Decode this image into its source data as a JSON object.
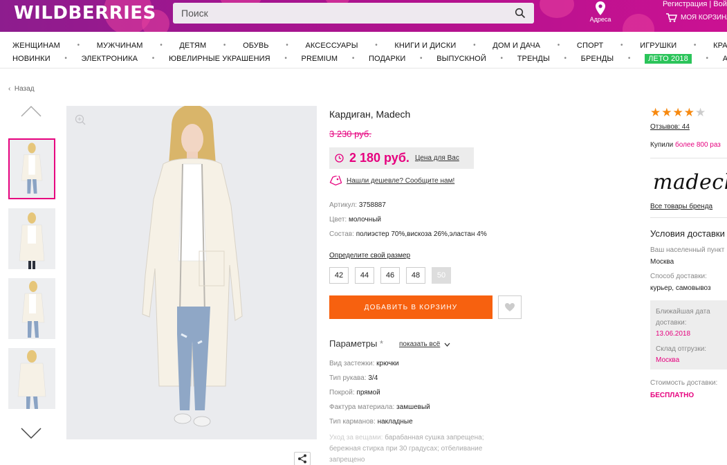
{
  "header": {
    "logo": "WILDBERRIES",
    "search_placeholder": "Поиск",
    "address_label": "Адреса",
    "auth": "Регистрация | Войт",
    "cart_label": "МОЯ КОРЗИНА"
  },
  "nav": {
    "row1": [
      "ЖЕНЩИНАМ",
      "МУЖЧИНАМ",
      "ДЕТЯМ",
      "ОБУВЬ",
      "АКСЕССУАРЫ",
      "КНИГИ И ДИСКИ",
      "ДОМ И ДАЧА",
      "СПОРТ",
      "ИГРУШКИ",
      "КРАСОТ"
    ],
    "row2": [
      "НОВИНКИ",
      "ЭЛЕКТРОНИКА",
      "ЮВЕЛИРНЫЕ УКРАШЕНИЯ",
      "PREMIUM",
      "ПОДАРКИ",
      "ВЫПУСКНОЙ",
      "ТРЕНДЫ",
      "БРЕНДЫ",
      "ЛЕТО 2018",
      "АКЦИ"
    ],
    "highlight": "ЛЕТО 2018"
  },
  "back_link": "Назад",
  "product": {
    "title": "Кардиган, Madech",
    "old_price": "3 230 руб.",
    "price": "2 180 руб.",
    "price_label": "Цена для Вас",
    "cheaper_link": "Нашли дешевле? Сообщите нам!",
    "specs": [
      {
        "key": "Артикул:",
        "value": "3758887"
      },
      {
        "key": "Цвет:",
        "value": "молочный"
      },
      {
        "key": "Состав:",
        "value": "полиэстер 70%,вискоза 26%,эластан 4%"
      }
    ],
    "size_link": "Определите свой размер",
    "sizes": [
      "42",
      "44",
      "46",
      "48",
      "50"
    ],
    "add_to_cart": "ДОБАВИТЬ В КОРЗИНУ",
    "params_title": "Параметры",
    "params_asterisk": "*",
    "show_all": "показать всё",
    "params": [
      {
        "key": "Вид застежки:",
        "value": "крючки"
      },
      {
        "key": "Тип рукава:",
        "value": "3/4"
      },
      {
        "key": "Покрой:",
        "value": "прямой"
      },
      {
        "key": "Фактура материала:",
        "value": "замшевый"
      },
      {
        "key": "Тип карманов:",
        "value": "накладные"
      }
    ],
    "care_key": "Уход за вещами:",
    "care_value": "барабанная сушка запрещена; бережная стирка при 30 градусах; отбеливание запрещено"
  },
  "sidebar": {
    "rating": 4,
    "rating_max": 5,
    "reviews": "Отзывов: 44",
    "bought_prefix": "Купили",
    "bought_link": "более 800 раз",
    "brand_name": "madech",
    "brand_link": "Все товары бренда",
    "delivery_title": "Условия доставки",
    "locality_label": "Ваш населенный пункт",
    "locality_value": "Москва",
    "method_label": "Способ доставки:",
    "method_value": "курьер, самовывоз",
    "nearest_label": "Ближайшая дата доставки:",
    "nearest_value": "13.06.2018",
    "warehouse_label": "Склад отгрузки:",
    "warehouse_value": "Москва",
    "cost_label": "Стоимость доставки:",
    "cost_value": "БЕСПЛАТНО"
  },
  "colors": {
    "brand": "#a3148f",
    "accent": "#e6007e",
    "cta": "#f7610f",
    "highlight": "#2bc45a",
    "star": "#f7890f"
  }
}
